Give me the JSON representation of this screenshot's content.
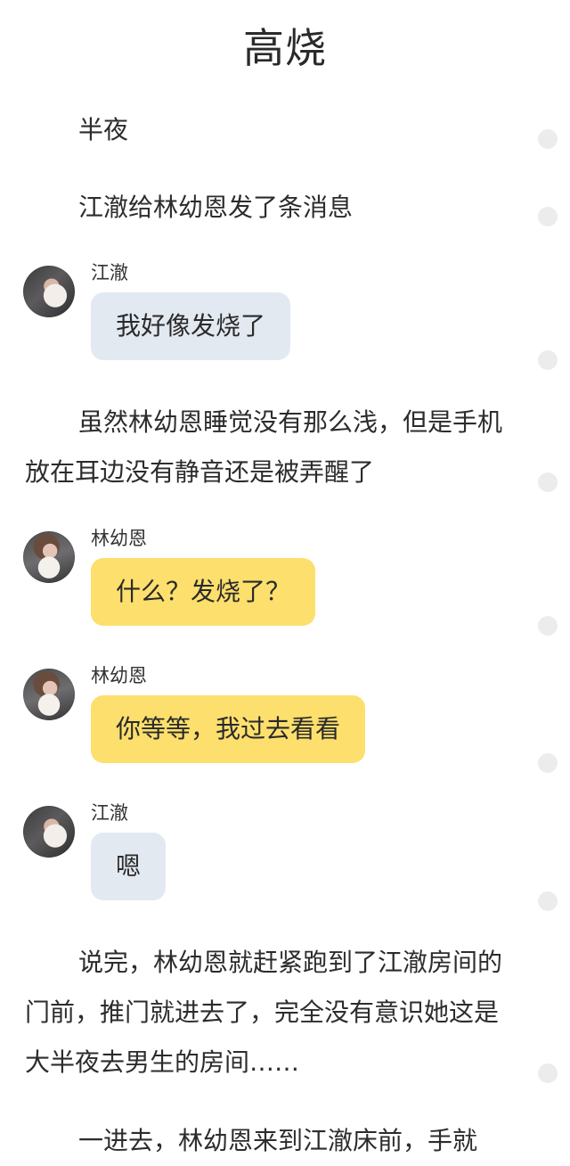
{
  "title": "高烧",
  "paragraphs": [
    "半夜",
    "江澈给林幼恩发了条消息",
    "虽然林幼恩睡觉没有那么浅，但是手机放在耳边没有静音还是被弄醒了",
    "说完，林幼恩就赶紧跑到了江澈房间的门前，推门就进去了，完全没有意识她这是大半夜去男生的房间……",
    "一进去，林幼恩来到江澈床前，手就"
  ],
  "messages": [
    {
      "sender": "江澈",
      "text": "我好像发烧了",
      "bubble_color": "#e3e9f1"
    },
    {
      "sender": "林幼恩",
      "text": "什么？发烧了？",
      "bubble_color": "#fddf6d"
    },
    {
      "sender": "林幼恩",
      "text": "你等等，我过去看看",
      "bubble_color": "#fddf6d"
    },
    {
      "sender": "江澈",
      "text": "嗯",
      "bubble_color": "#e3e9f1"
    }
  ],
  "colors": {
    "accent_yellow": "#fddf6d",
    "bubble_gray": "#e3e9f1",
    "background": "#ffffff"
  }
}
